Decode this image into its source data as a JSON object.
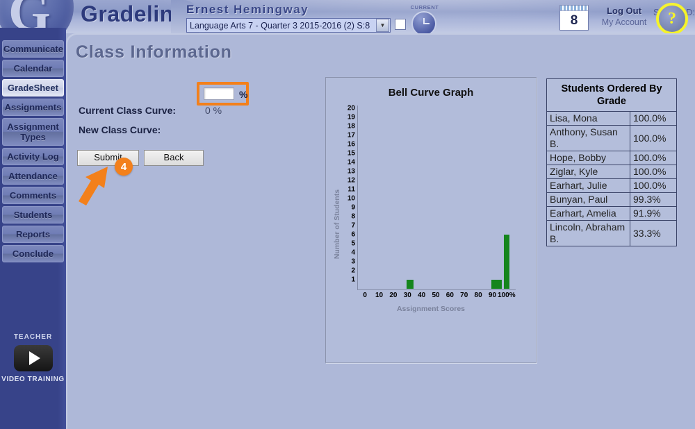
{
  "header": {
    "brand": "Gradelink",
    "logo_letter": "G",
    "teacher_name": "Ernest Hemingway",
    "course_selected": "Language Arts 7 - Quarter 3 2015-2016 (2) S:8",
    "current_label": "CURRENT",
    "calendar_day": "8",
    "logout": "Log Out",
    "my_account": "My Account",
    "school_id": "School ID:",
    "help_glyph": "?"
  },
  "sidebar": {
    "items": [
      {
        "label": "Communicate",
        "active": false
      },
      {
        "label": "Calendar",
        "active": false
      },
      {
        "label": "GradeSheet",
        "active": true
      },
      {
        "label": "Assignments",
        "active": false
      },
      {
        "label": "Assignment Types",
        "active": false
      },
      {
        "label": "Activity Log",
        "active": false
      },
      {
        "label": "Attendance",
        "active": false
      },
      {
        "label": "Comments",
        "active": false
      },
      {
        "label": "Students",
        "active": false
      },
      {
        "label": "Reports",
        "active": false
      },
      {
        "label": "Conclude",
        "active": false
      }
    ],
    "video": {
      "title": "TEACHER",
      "subtitle": "VIDEO TRAINING"
    }
  },
  "main": {
    "page_title": "Class Information",
    "current_curve_label": "Current Class Curve:",
    "current_curve_value": "0 %",
    "new_curve_label": "New Class Curve:",
    "new_curve_value": "",
    "new_curve_placeholder": "",
    "percent_symbol": "%",
    "submit_label": "Submit",
    "back_label": "Back",
    "step_badge": "4",
    "highlight_color": "#f3801b"
  },
  "chart_data": {
    "type": "bar",
    "title": "Bell Curve Graph",
    "xlabel": "Assignment Scores",
    "ylabel": "Number of Students",
    "xtick_labels": [
      "0",
      "10",
      "20",
      "30",
      "40",
      "50",
      "60",
      "70",
      "80",
      "90",
      "100%"
    ],
    "xtick_values": [
      0,
      10,
      20,
      30,
      40,
      50,
      60,
      70,
      80,
      90,
      100
    ],
    "ytick_labels": [
      "20",
      "19",
      "18",
      "17",
      "16",
      "15",
      "14",
      "13",
      "12",
      "11",
      "10",
      "9",
      "8",
      "7",
      "6",
      "5",
      "4",
      "3",
      "2",
      "1"
    ],
    "ylim": [
      0,
      20
    ],
    "xlim": [
      -5,
      105
    ],
    "grid": false,
    "bar_color": "#15851c",
    "bars": [
      {
        "x": 32,
        "width": 5,
        "value": 1
      },
      {
        "x": 93,
        "width": 7,
        "value": 1
      },
      {
        "x": 100,
        "width": 4,
        "value": 6
      }
    ]
  },
  "students_panel": {
    "header": "Students Ordered By Grade",
    "rows": [
      {
        "name": "Lisa, Mona",
        "grade": "100.0%"
      },
      {
        "name": "Anthony, Susan B.",
        "grade": "100.0%"
      },
      {
        "name": "Hope, Bobby",
        "grade": "100.0%"
      },
      {
        "name": "Ziglar, Kyle",
        "grade": "100.0%"
      },
      {
        "name": "Earhart, Julie",
        "grade": "100.0%"
      },
      {
        "name": "Bunyan, Paul",
        "grade": "99.3%"
      },
      {
        "name": "Earhart, Amelia",
        "grade": "91.9%"
      },
      {
        "name": "Lincoln, Abraham B.",
        "grade": "33.3%"
      }
    ]
  }
}
